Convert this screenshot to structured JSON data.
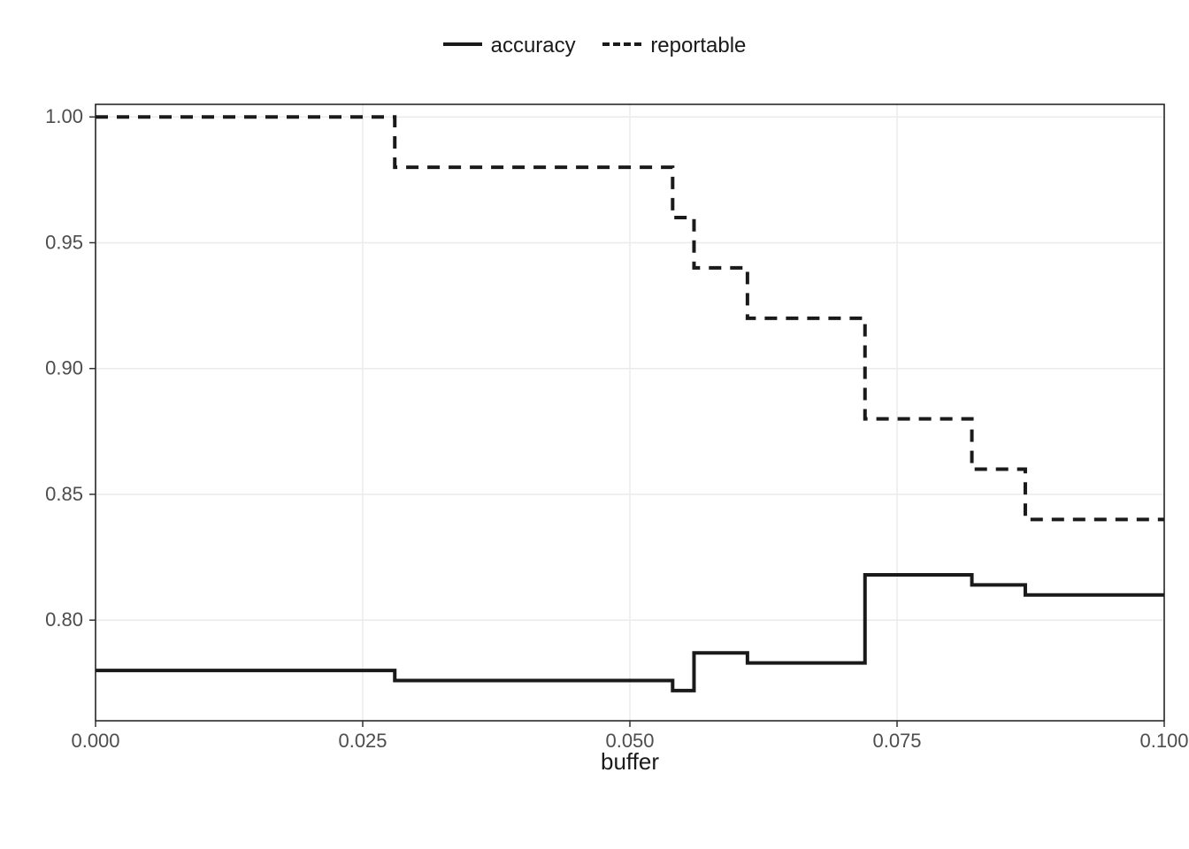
{
  "chart_data": {
    "type": "line",
    "title": "",
    "xlabel": "buffer",
    "ylabel": "",
    "xlim": [
      0,
      0.1
    ],
    "ylim": [
      0.76,
      1.005
    ],
    "x_ticks": [
      0.0,
      0.025,
      0.05,
      0.075,
      0.1
    ],
    "x_tick_labels": [
      "0.000",
      "0.025",
      "0.050",
      "0.075",
      "0.100"
    ],
    "y_ticks": [
      0.8,
      0.85,
      0.9,
      0.95,
      1.0
    ],
    "y_tick_labels": [
      "0.80",
      "0.85",
      "0.90",
      "0.95",
      "1.00"
    ],
    "legend_items": [
      "accuracy",
      "reportable"
    ],
    "series": [
      {
        "name": "accuracy",
        "linetype": "solid",
        "x": [
          0.0,
          0.028,
          0.028,
          0.054,
          0.054,
          0.056,
          0.056,
          0.061,
          0.061,
          0.072,
          0.072,
          0.082,
          0.082,
          0.087,
          0.087,
          0.1
        ],
        "y": [
          0.78,
          0.78,
          0.776,
          0.776,
          0.772,
          0.772,
          0.787,
          0.787,
          0.783,
          0.783,
          0.818,
          0.818,
          0.814,
          0.814,
          0.81,
          0.81
        ]
      },
      {
        "name": "reportable",
        "linetype": "dashed",
        "x": [
          0.0,
          0.028,
          0.028,
          0.054,
          0.054,
          0.056,
          0.056,
          0.061,
          0.061,
          0.072,
          0.072,
          0.082,
          0.082,
          0.087,
          0.087,
          0.1
        ],
        "y": [
          1.0,
          1.0,
          0.98,
          0.98,
          0.96,
          0.96,
          0.94,
          0.94,
          0.92,
          0.92,
          0.88,
          0.88,
          0.86,
          0.86,
          0.84,
          0.84
        ]
      }
    ]
  }
}
